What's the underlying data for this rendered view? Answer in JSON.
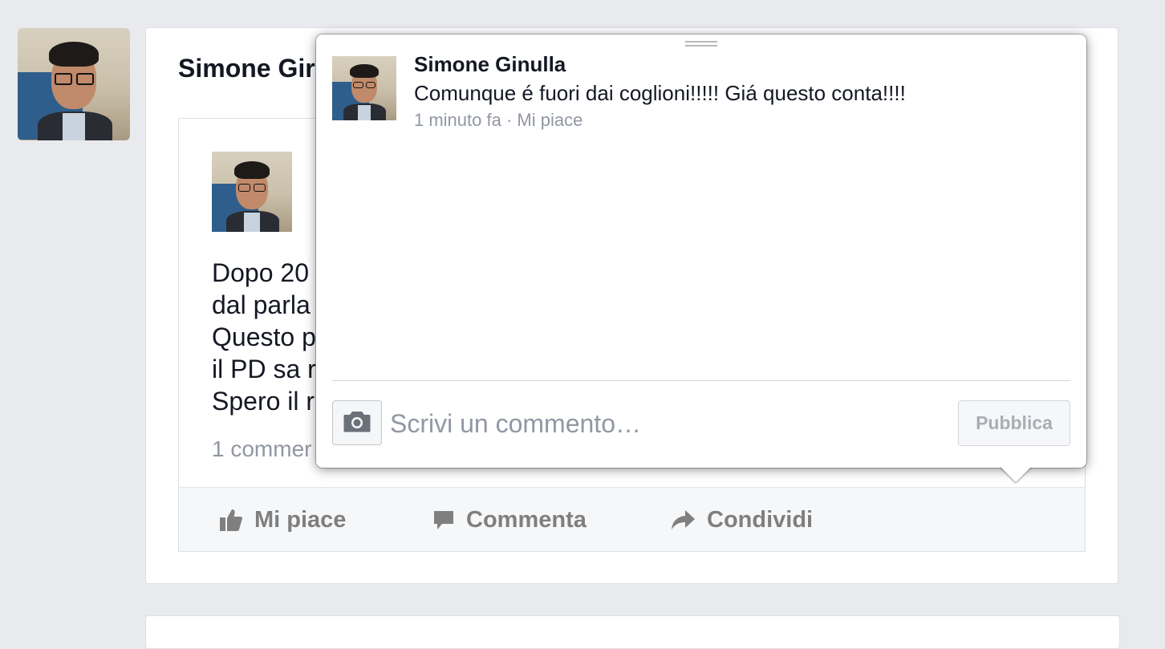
{
  "post": {
    "author_name_visible": "Simone Gir",
    "text_lines": [
      "Dopo 20",
      "dal parla",
      "Questo p",
      "il PD sa r",
      "Spero il r"
    ],
    "comment_count": "1 commer",
    "actions": {
      "like": "Mi piace",
      "comment": "Commenta",
      "share": "Condividi"
    }
  },
  "comments_popup": {
    "comment": {
      "author": "Simone Ginulla",
      "text": "Comunque é fuori dai coglioni!!!!! Giá questo conta!!!!",
      "time": "1 minuto fa",
      "separator": " · ",
      "like_label": "Mi piace"
    },
    "composer": {
      "placeholder": "Scrivi un commento…",
      "publish_label": "Pubblica"
    }
  },
  "icons": {
    "like": "thumbs-up-icon",
    "comment": "speech-bubble-icon",
    "share": "share-arrow-icon",
    "camera": "camera-icon"
  },
  "colors": {
    "background": "#e9eaed",
    "action_text": "#7f7f7f",
    "meta_text": "#9197a3"
  }
}
